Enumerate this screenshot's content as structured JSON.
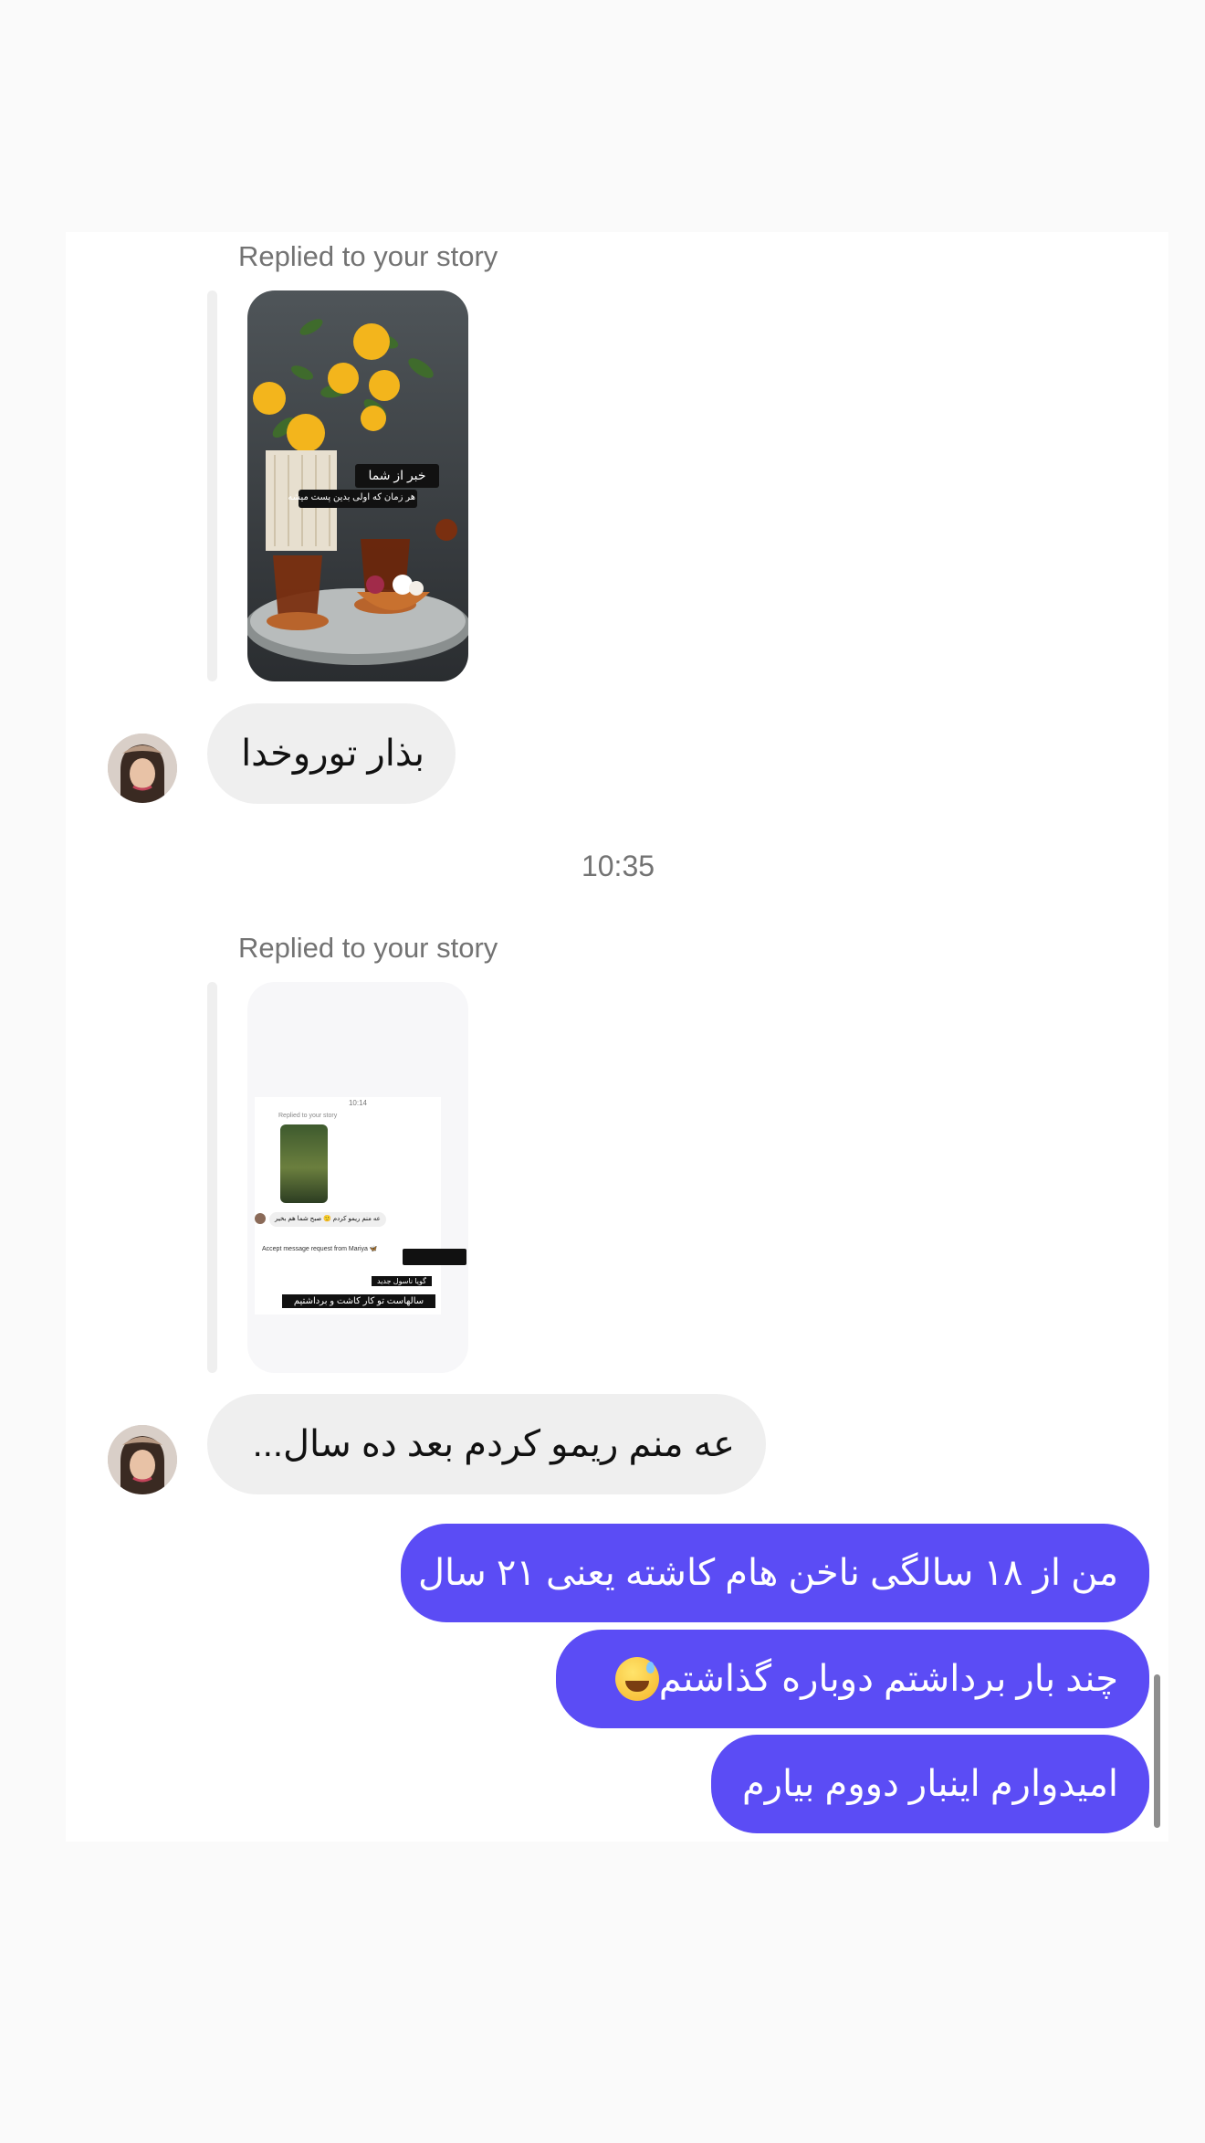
{
  "thread": {
    "reply_label_1": "Replied to your story",
    "reply_label_2": "Replied to your story",
    "timestamp": "10:35",
    "story1_overlay": {
      "line1": "خبر از شما",
      "line2": "هر زمان که اولی بدین پست میشه"
    },
    "story2_overlay": {
      "time": "10:14",
      "replied": "Replied to your story",
      "msg": "عه منم ریمو کردم 🙂 صبح شما هم بخیر",
      "request": "Accept message request from Mariya 🦋",
      "caption1": "گویا ناسول جدید",
      "caption2": "سالهاست تو کار کاشت و برداشتیم"
    },
    "incoming": [
      "بذار توروخدا",
      "عه منم ریمو کردم بعد ده سال..."
    ],
    "outgoing": [
      "من از ۱۸ سالگی ناخن هام کاشته یعنی ۲۱ سال",
      "چند بار برداشتم دوباره گذاشتم",
      "امیدوارم اینبار دووم بیارم"
    ],
    "outgoing_emoji": "grinning-sweat-emoji"
  },
  "colors": {
    "outgoing_bubble": "#5b4cf5",
    "incoming_bubble": "#efefef",
    "secondary_text": "#737373"
  }
}
